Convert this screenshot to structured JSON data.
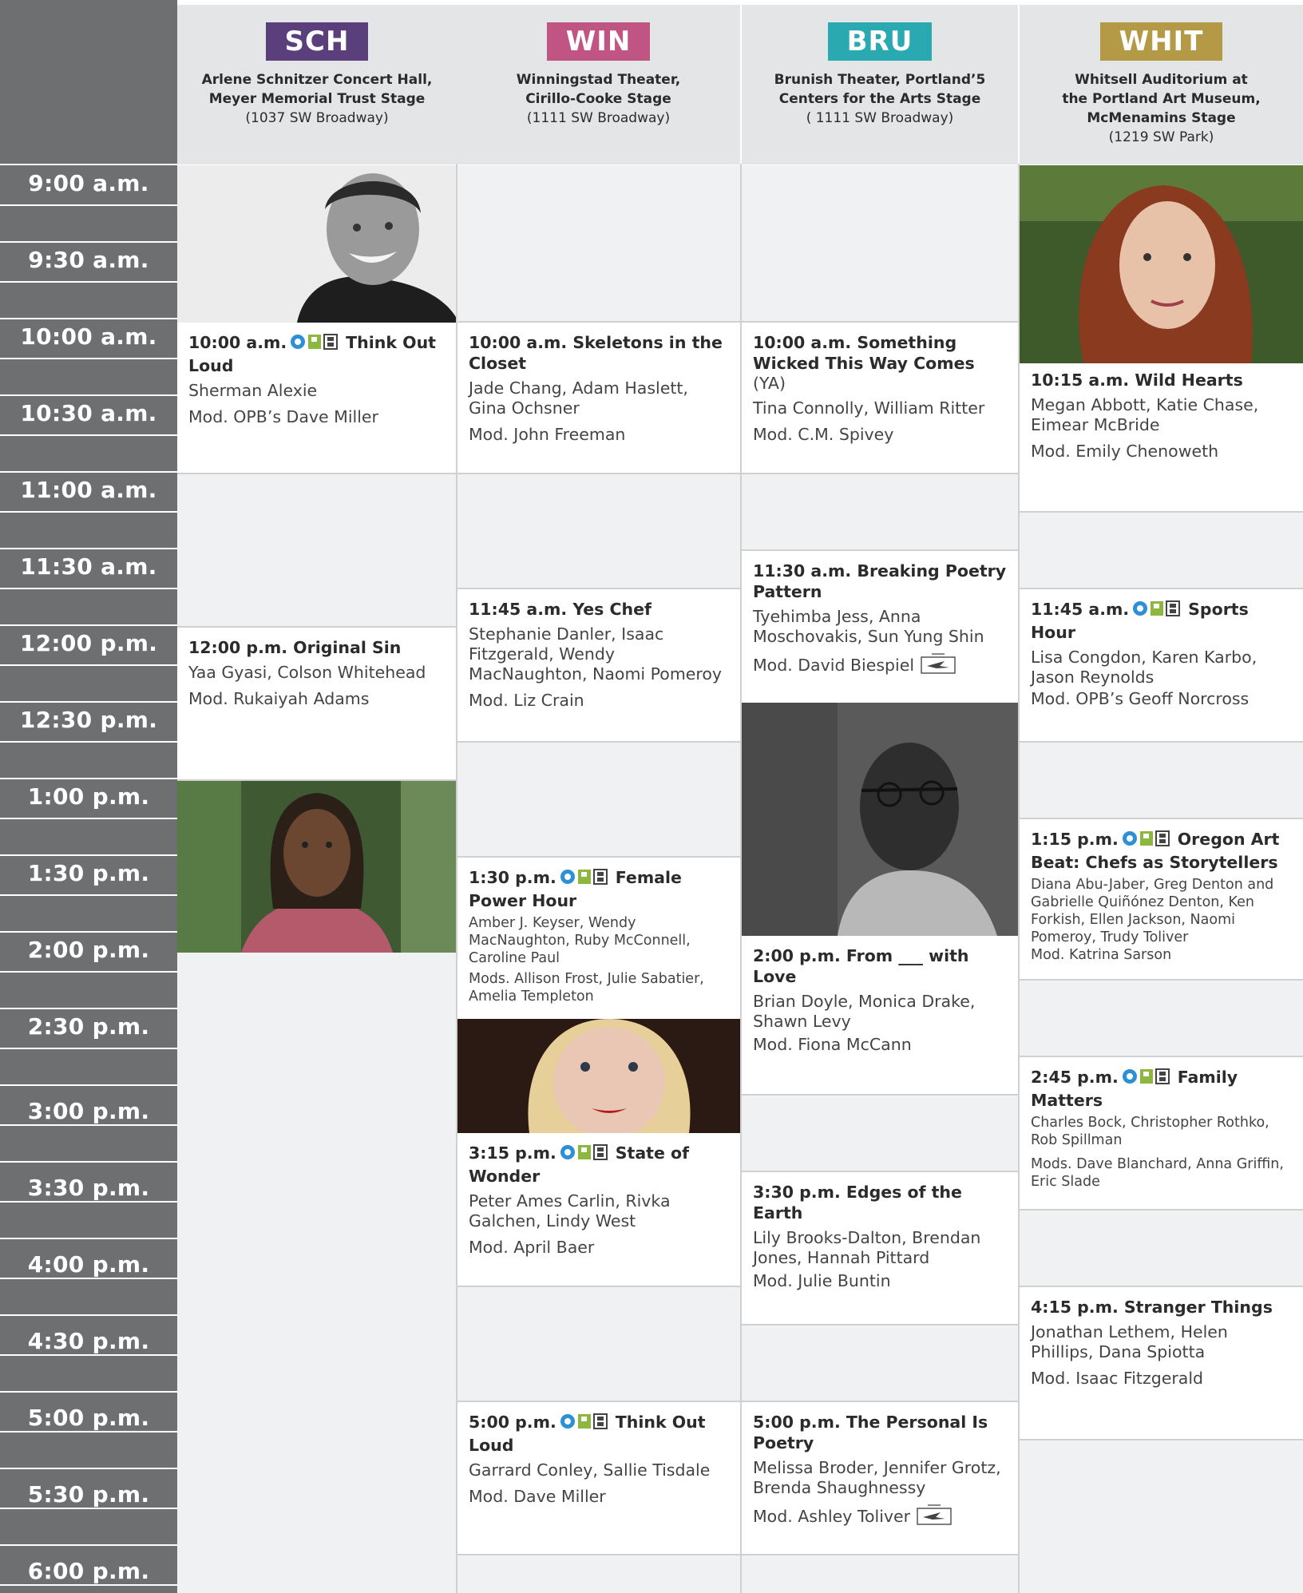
{
  "times": [
    "9:00 a.m.",
    "9:30 a.m.",
    "10:00 a.m.",
    "10:30 a.m.",
    "11:00 a.m.",
    "11:30 a.m.",
    "12:00 p.m.",
    "12:30 p.m.",
    "1:00 p.m.",
    "1:30 p.m.",
    "2:00 p.m.",
    "2:30 p.m.",
    "3:00 p.m.",
    "3:30 p.m.",
    "4:00 p.m.",
    "4:30 p.m.",
    "5:00 p.m.",
    "5:30 p.m.",
    "6:00 p.m."
  ],
  "venues": [
    {
      "code": "SCH",
      "color": "#5b3e7c",
      "name_lines": [
        "Arlene Schnitzer Concert Hall,",
        "Meyer Memorial Trust Stage"
      ],
      "address": "(1037 SW Broadway)"
    },
    {
      "code": "WIN",
      "color": "#c05482",
      "name_lines": [
        "Winningstad Theater,",
        "Cirillo-Cooke Stage"
      ],
      "address": "(1111 SW Broadway)"
    },
    {
      "code": "BRU",
      "color": "#2aa9b0",
      "name_lines": [
        "Brunish Theater, Portland’5",
        "Centers for the Arts Stage"
      ],
      "address": "( 1111 SW Broadway)"
    },
    {
      "code": "WHIT",
      "color": "#b49a47",
      "name_lines": [
        "Whitsell Auditorium at",
        "the Portland Art Museum,",
        "McMenamins Stage"
      ],
      "address": "(1219 SW Park)"
    }
  ],
  "events": {
    "sch": [
      {
        "time": "10:00 a.m.",
        "opb": true,
        "title": "Think Out Loud",
        "names": "Sherman Alexie",
        "mod": "Mod. OPB’s Dave Miller"
      },
      {
        "time": "12:00 p.m.",
        "opb": false,
        "title": "Original Sin",
        "names": "Yaa Gyasi, Colson Whitehead",
        "mod": "Mod. Rukaiyah Adams"
      }
    ],
    "win": [
      {
        "time": "10:00 a.m.",
        "opb": false,
        "title": "Skeletons in the Closet",
        "names": "Jade Chang, Adam Haslett, Gina Ochsner",
        "mod": "Mod. John Freeman"
      },
      {
        "time": "11:45 a.m.",
        "opb": false,
        "title": "Yes Chef",
        "names": "Stephanie Danler, Isaac Fitzgerald, Wendy MacNaughton, Naomi Pomeroy",
        "mod": "Mod. Liz Crain"
      },
      {
        "time": "1:30 p.m.",
        "opb": true,
        "title": "Female Power Hour",
        "names": "Amber J. Keyser, Wendy MacNaughton, Ruby McConnell, Caroline Paul",
        "mod": "Mods. Allison Frost, Julie Sabatier, Amelia Templeton"
      },
      {
        "time": "3:15 p.m.",
        "opb": true,
        "title": "State of Wonder",
        "names": "Peter Ames Carlin, Rivka Galchen, Lindy West",
        "mod": "Mod. April Baer"
      },
      {
        "time": "5:00 p.m.",
        "opb": true,
        "title": "Think Out Loud",
        "names": "Garrard Conley, Sallie Tisdale",
        "mod": "Mod. Dave Miller"
      }
    ],
    "bru": [
      {
        "time": "10:00 a.m.",
        "opb": false,
        "title": "Something Wicked This Way Comes",
        "subtitle": "(YA)",
        "names": "Tina Connolly, William Ritter",
        "mod": "Mod. C.M. Spivey"
      },
      {
        "time": "11:30 a.m.",
        "opb": false,
        "title": "Breaking Poetry Pattern",
        "names": "Tyehimba Jess, Anna Moschovakis, Sun Yung Shin",
        "mod": "Mod. David Biespiel",
        "poetry_logo": true
      },
      {
        "time": "2:00 p.m.",
        "opb": false,
        "title": "From ___ with Love",
        "names": "Brian Doyle, Monica Drake, Shawn Levy",
        "mod": "Mod. Fiona McCann"
      },
      {
        "time": "3:30 p.m.",
        "opb": false,
        "title": "Edges of the Earth",
        "names": "Lily Brooks-Dalton, Brendan Jones, Hannah Pittard",
        "mod": "Mod. Julie Buntin"
      },
      {
        "time": "5:00 p.m.",
        "opb": false,
        "title": "The Personal Is Poetry",
        "names": "Melissa Broder, Jennifer Grotz, Brenda Shaughnessy",
        "mod": "Mod. Ashley Toliver",
        "poetry_logo": true
      }
    ],
    "whit": [
      {
        "time": "10:15 a.m.",
        "opb": false,
        "title": "Wild Hearts",
        "names": "Megan Abbott, Katie Chase, Eimear McBride",
        "mod": "Mod. Emily Chenoweth"
      },
      {
        "time": "11:45 a.m.",
        "opb": true,
        "title": "Sports Hour",
        "names": "Lisa Congdon, Karen Karbo, Jason Reynolds",
        "mod": "Mod. OPB’s Geoff Norcross"
      },
      {
        "time": "1:15 p.m.",
        "opb": true,
        "title": "Oregon Art Beat: Chefs as Storytellers",
        "names": "Diana Abu-Jaber, Greg Denton and Gabrielle Quiñónez Denton, Ken Forkish, Ellen Jackson, Naomi Pomeroy, Trudy Toliver",
        "mod": "Mod. Katrina Sarson"
      },
      {
        "time": "2:45 p.m.",
        "opb": true,
        "title": "Family Matters",
        "names": "Charles Bock, Christopher Rothko, Rob Spillman",
        "mod": "Mods. Dave Blanchard, Anna Griffin, Eric Slade"
      },
      {
        "time": "4:15 p.m.",
        "opb": false,
        "title": "Stranger Things",
        "names": "Jonathan Lethem, Helen Phillips, Dana Spiotta",
        "mod": "Mod. Isaac Fitzgerald"
      }
    ]
  }
}
